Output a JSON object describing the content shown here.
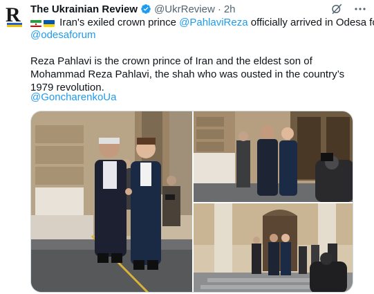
{
  "author": {
    "name": "The Ukrainian Review",
    "handle": "@UkrReview",
    "separator": "·",
    "time": "2h"
  },
  "icons": {
    "avatar": "ukrainian-review-logo",
    "verified": "verified-badge-icon",
    "grok": "grok-icon",
    "more": "more-icon"
  },
  "tweet": {
    "line1_text": "Iran's exiled crown prince ",
    "line1_mention": "@PahlaviReza",
    "line1_tail": " officially arrived in Odesa for",
    "line2_mention": "@odesaforum",
    "paragraph": "Reza Pahlavi is the crown prince of Iran and the eldest son of Mohammad Reza Pahlavi, the shah who was ousted in the country’s 1979 revolution.",
    "mention3": "@GoncharenkoUa"
  },
  "flags": [
    "iran-flag",
    "ukraine-flag"
  ],
  "media": {
    "photos": [
      "photo-handshake-closeup",
      "photo-handshake-entrance",
      "photo-handshake-steps"
    ]
  },
  "colors": {
    "link": "#1d9bf0",
    "verified": "#1d9bf0",
    "secondary_text": "#536471"
  }
}
